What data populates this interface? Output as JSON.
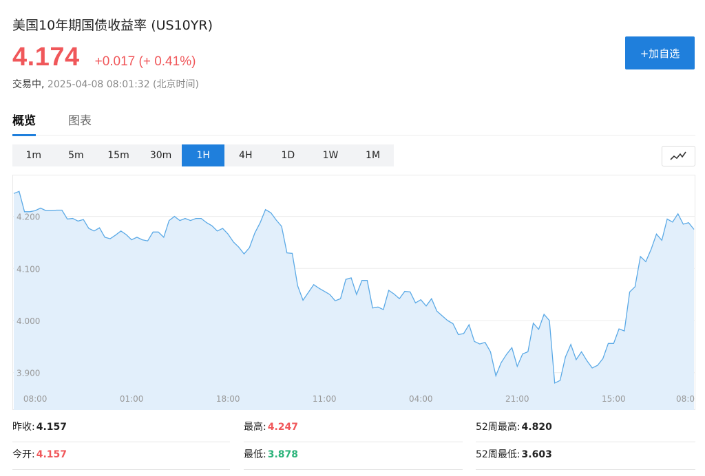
{
  "header": {
    "title": "美国10年期国债收益率 (US10YR)",
    "price": "4.174",
    "change": "+0.017 (+ 0.41%)",
    "status_prefix": "交易中,",
    "timestamp": "2025-04-08 08:01:32 (北京时间)",
    "add_button": "+加自选"
  },
  "tabs": [
    {
      "label": "概览",
      "active": true
    },
    {
      "label": "图表",
      "active": false
    }
  ],
  "intervals": [
    {
      "label": "1m"
    },
    {
      "label": "5m"
    },
    {
      "label": "15m"
    },
    {
      "label": "30m"
    },
    {
      "label": "1H",
      "active": true
    },
    {
      "label": "4H"
    },
    {
      "label": "1D"
    },
    {
      "label": "1W"
    },
    {
      "label": "1M"
    }
  ],
  "colors": {
    "accent": "#1f7fdc",
    "up": "#f0575a",
    "down": "#2bb37a",
    "line": "#5aa9e6",
    "area": "#e2effb"
  },
  "icons": {
    "chart_toggle": "line-chart-icon"
  },
  "chart_data": {
    "type": "area",
    "title": "",
    "xlabel": "",
    "ylabel": "",
    "ylim": [
      3.86,
      4.28
    ],
    "yticks": [
      "4.200",
      "4.100",
      "4.000",
      "3.900"
    ],
    "ytick_values": [
      4.2,
      4.1,
      4.0,
      3.9
    ],
    "xtick_labels": [
      "08:00",
      "01:00",
      "18:00",
      "11:00",
      "04:00",
      "21:00",
      "15:00",
      "08:0"
    ],
    "xtick_index": [
      4,
      22,
      40,
      58,
      76,
      94,
      112,
      130
    ],
    "grid": true,
    "series": [
      {
        "values": [
          4.244,
          4.248,
          4.209,
          4.209,
          4.211,
          4.216,
          4.211,
          4.211,
          4.212,
          4.212,
          4.195,
          4.196,
          4.191,
          4.194,
          4.177,
          4.172,
          4.178,
          4.16,
          4.157,
          4.164,
          4.172,
          4.165,
          4.155,
          4.16,
          4.155,
          4.153,
          4.17,
          4.17,
          4.16,
          4.192,
          4.2,
          4.192,
          4.196,
          4.192,
          4.196,
          4.196,
          4.188,
          4.182,
          4.172,
          4.177,
          4.166,
          4.151,
          4.141,
          4.128,
          4.14,
          4.168,
          4.188,
          4.213,
          4.207,
          4.193,
          4.181,
          4.13,
          4.129,
          4.067,
          4.039,
          4.054,
          4.069,
          4.062,
          4.056,
          4.05,
          4.038,
          4.042,
          4.079,
          4.082,
          4.05,
          4.077,
          4.077,
          4.024,
          4.026,
          4.021,
          4.058,
          4.051,
          4.042,
          4.056,
          4.055,
          4.034,
          4.04,
          4.028,
          4.042,
          4.018,
          4.009,
          4.0,
          3.994,
          3.973,
          3.975,
          3.992,
          3.96,
          3.955,
          3.958,
          3.94,
          3.894,
          3.919,
          3.935,
          3.948,
          3.912,
          3.936,
          3.94,
          3.995,
          3.983,
          4.012,
          4.0,
          3.88,
          3.885,
          3.93,
          3.954,
          3.925,
          3.94,
          3.923,
          3.909,
          3.914,
          3.927,
          3.956,
          3.956,
          3.984,
          3.98,
          4.055,
          4.065,
          4.123,
          4.113,
          4.137,
          4.166,
          4.154,
          4.195,
          4.189,
          4.205,
          4.185,
          4.188,
          4.175
        ]
      }
    ]
  },
  "stats": [
    {
      "label": "昨收:",
      "value": "4.157",
      "tone": ""
    },
    {
      "label": "最高:",
      "value": "4.247",
      "tone": "red"
    },
    {
      "label": "52周最高:",
      "value": "4.820",
      "tone": ""
    },
    {
      "label": "今开:",
      "value": "4.157",
      "tone": "red"
    },
    {
      "label": "最低:",
      "value": "3.878",
      "tone": "green"
    },
    {
      "label": "52周最低:",
      "value": "3.603",
      "tone": ""
    }
  ]
}
